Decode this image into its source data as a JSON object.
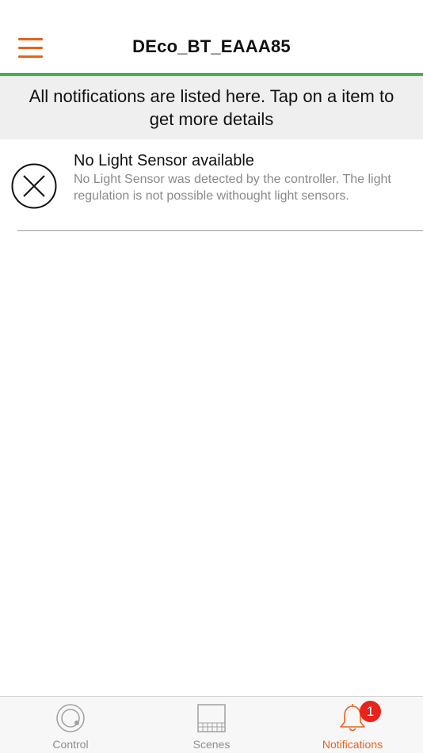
{
  "header": {
    "title": "DEco_BT_EAAA85",
    "accent_color": "#e8621c",
    "status_bar_color": "#3fb34f"
  },
  "banner": {
    "text": "All notifications are listed here. Tap on a item to get more details"
  },
  "notifications": [
    {
      "icon": "circle-x-icon",
      "title": "No Light Sensor available",
      "description": "No Light Sensor was detected by the controller. The light regulation is not possible withought light sensors."
    }
  ],
  "tabbar": {
    "tabs": [
      {
        "label": "Control",
        "icon": "control-icon",
        "active": false
      },
      {
        "label": "Scenes",
        "icon": "scenes-icon",
        "active": false
      },
      {
        "label": "Notifications",
        "icon": "bell-icon",
        "active": true
      }
    ],
    "notifications_badge": "1"
  }
}
